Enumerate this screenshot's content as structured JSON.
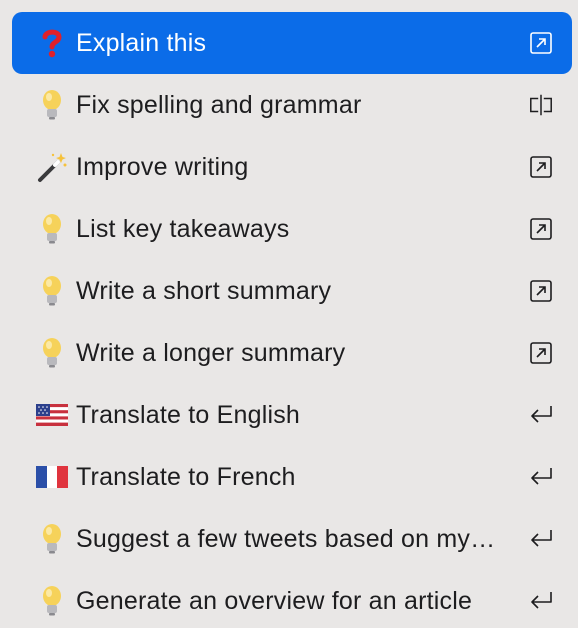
{
  "menu": {
    "items": [
      {
        "label": "Explain this",
        "icon": "question-mark-icon",
        "action": "open-in-window-icon",
        "selected": true
      },
      {
        "label": "Fix spelling and grammar",
        "icon": "lightbulb-icon",
        "action": "split-compare-icon",
        "selected": false
      },
      {
        "label": "Improve writing",
        "icon": "magic-wand-icon",
        "action": "open-in-window-icon",
        "selected": false
      },
      {
        "label": "List key takeaways",
        "icon": "lightbulb-icon",
        "action": "open-in-window-icon",
        "selected": false
      },
      {
        "label": "Write a short summary",
        "icon": "lightbulb-icon",
        "action": "open-in-window-icon",
        "selected": false
      },
      {
        "label": "Write a longer summary",
        "icon": "lightbulb-icon",
        "action": "open-in-window-icon",
        "selected": false
      },
      {
        "label": "Translate to English",
        "icon": "us-flag-icon",
        "action": "return-icon",
        "selected": false
      },
      {
        "label": "Translate to French",
        "icon": "french-flag-icon",
        "action": "return-icon",
        "selected": false
      },
      {
        "label": "Suggest a few tweets based on my…",
        "icon": "lightbulb-icon",
        "action": "return-icon",
        "selected": false
      },
      {
        "label": "Generate an overview for an article",
        "icon": "lightbulb-icon",
        "action": "return-icon",
        "selected": false
      }
    ]
  },
  "colors": {
    "background": "#e9e7e6",
    "selected": "#0b6ce8",
    "text": "#1d1d1f",
    "question_red": "#e0202a",
    "bulb_yellow": "#f6d25a"
  }
}
